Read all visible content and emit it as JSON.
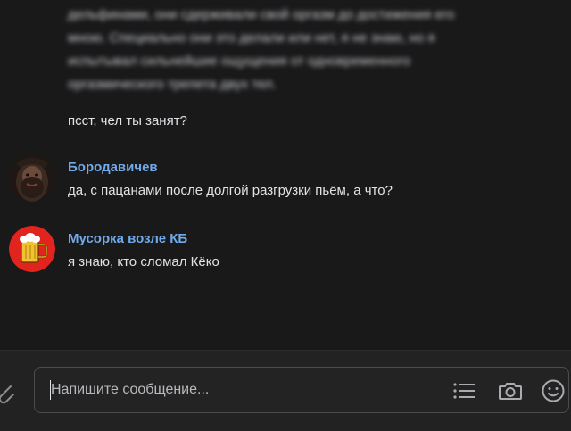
{
  "feed": {
    "blurred_message": {
      "lines": [
        "дельфинами, они сдерживали свой оргазм до достижения его",
        "мною. Специально они это делали или нет, я не знаю, но я",
        "испытывал сильнейшие ощущения от одновременного",
        "оргазмического трепета двух тел."
      ]
    },
    "messages": [
      {
        "author": "",
        "text": "псст, чел ты занят?"
      },
      {
        "author": "Бородавичев",
        "text": "да, с пацанами после долгой разгрузки пьём, а что?",
        "avatar_icon": "bearded-man-avatar"
      },
      {
        "author": "Мусорка возле КБ",
        "text": "я знаю, кто сломал Кёко",
        "avatar_icon": "beer-mug-avatar"
      }
    ]
  },
  "composer": {
    "placeholder": "Напишите сообщение...",
    "value": "",
    "icons": [
      "paperclip-icon",
      "list-icon",
      "camera-icon",
      "emoji-icon"
    ]
  },
  "colors": {
    "background": "#19191a",
    "author_name": "#71aaeb",
    "text": "#e1e3e6",
    "composer_border": "#4b4c4e"
  }
}
